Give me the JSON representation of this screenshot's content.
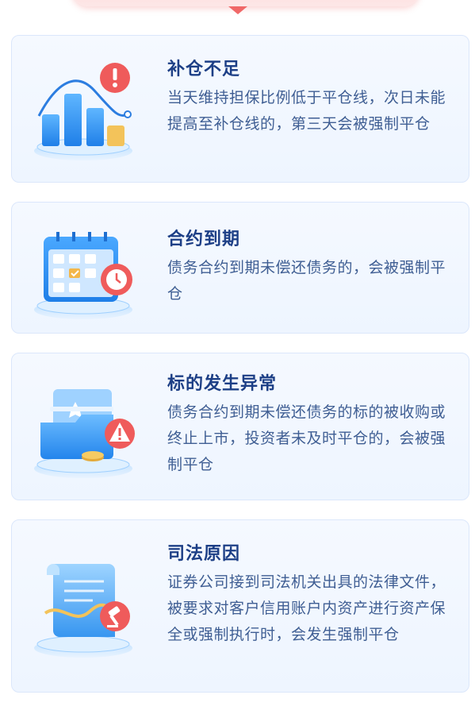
{
  "colors": {
    "card_bg": "#f2f7ff",
    "card_border": "#dbe7fb",
    "title": "#1d3f86",
    "desc": "#3f5e93",
    "accent_blue": "#3a9bf0",
    "alert_red": "#ef5b5b"
  },
  "cards": [
    {
      "title": "补仓不足",
      "desc": "当天维持担保比例低于平仓线，次日未能提高至补仓线的，第三天会被强制平仓",
      "icon": "bar-chart-alert-icon"
    },
    {
      "title": "合约到期",
      "desc": "债务合约到期未偿还债务的，会被强制平仓",
      "icon": "calendar-clock-icon"
    },
    {
      "title": "标的发生异常",
      "desc": "债务合约到期未偿还债务的标的被收购或终止上市，投资者未及时平仓的，会被强制平仓",
      "icon": "folder-alert-icon"
    },
    {
      "title": "司法原因",
      "desc": "证券公司接到司法机关出具的法律文件，被要求对客户信用账户内资产进行资产保全或强制执行时，会发生强制平仓",
      "icon": "document-gavel-icon"
    }
  ]
}
